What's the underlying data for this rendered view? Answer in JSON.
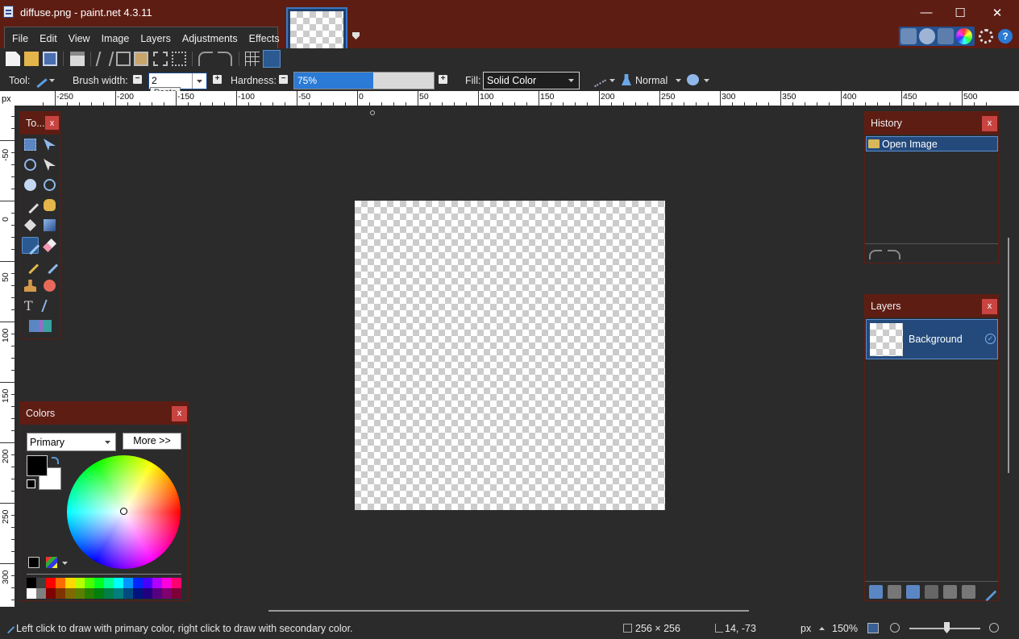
{
  "window": {
    "title": "diffuse.png - paint.net 4.3.11",
    "minimize": "—",
    "maximize": "☐",
    "close": "✕"
  },
  "menu": [
    {
      "label": "File"
    },
    {
      "label": "Edit"
    },
    {
      "label": "View"
    },
    {
      "label": "Image"
    },
    {
      "label": "Layers"
    },
    {
      "label": "Adjustments"
    },
    {
      "label": "Effects"
    }
  ],
  "tool_options": {
    "tool_label": "Tool:",
    "brush_width_label": "Brush width:",
    "brush_width_value": "2",
    "tooltip": "Paste",
    "hardness_label": "Hardness:",
    "hardness_value": "75%",
    "hardness_fraction": 0.75,
    "fill_label": "Fill:",
    "fill_value": "Solid Color",
    "blend_mode": "Normal"
  },
  "rulers": {
    "unit": "px",
    "h_labels": [
      "-250",
      "-200",
      "-150",
      "-100",
      "-50",
      "0",
      "50",
      "100",
      "150",
      "200",
      "250",
      "300",
      "350",
      "400",
      "450",
      "500"
    ],
    "v_labels": [
      "-50",
      "0",
      "50",
      "100",
      "150",
      "200",
      "250",
      "300"
    ]
  },
  "panels": {
    "tools": {
      "title": "To...",
      "close": "x"
    },
    "history": {
      "title": "History",
      "close": "x",
      "items": [
        "Open Image"
      ]
    },
    "layers": {
      "title": "Layers",
      "close": "x",
      "items": [
        {
          "name": "Background",
          "visible": true
        }
      ]
    },
    "colors": {
      "title": "Colors",
      "close": "x",
      "mode": "Primary",
      "more_button": "More >>",
      "primary_color": "#000000",
      "secondary_color": "#ffffff"
    }
  },
  "palette": {
    "top": [
      "#000000",
      "#404040",
      "#ff0000",
      "#ff6a00",
      "#ffd800",
      "#b6ff00",
      "#4cff00",
      "#00ff21",
      "#00ff90",
      "#00ffff",
      "#0094ff",
      "#0026ff",
      "#4800ff",
      "#b200ff",
      "#ff00dc",
      "#ff006e"
    ],
    "bottom": [
      "#ffffff",
      "#808080",
      "#7f0000",
      "#7f3300",
      "#7f6a00",
      "#5b7f00",
      "#267f00",
      "#007f0e",
      "#007f46",
      "#007f7f",
      "#004a7f",
      "#00137f",
      "#21007f",
      "#57007f",
      "#7f006e",
      "#7f0037"
    ]
  },
  "status": {
    "hint": "Left click to draw with primary color, right click to draw with secondary color.",
    "image_size": "256 × 256",
    "cursor_pos": "14, -73",
    "units": "px",
    "zoom": "150%"
  },
  "colors": {
    "titlebar": "#5e1d13",
    "accent": "#2a7ad6",
    "background": "#2b2b2b"
  }
}
